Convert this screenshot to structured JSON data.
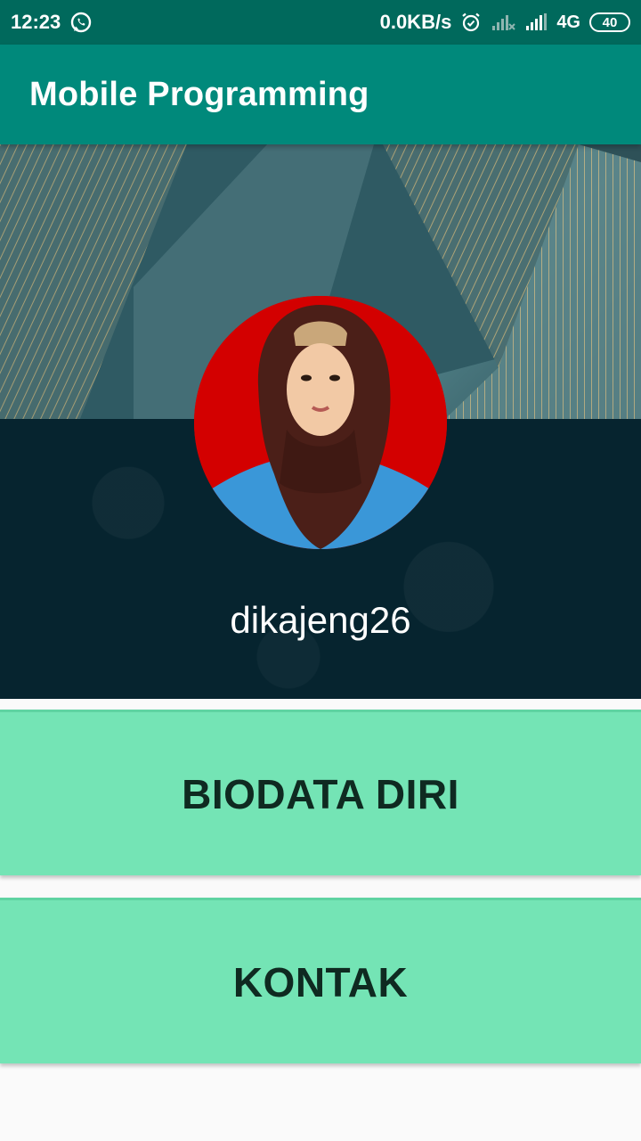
{
  "status_bar": {
    "time": "12:23",
    "app_icon": "whatsapp-icon",
    "net_speed": "0.0KB/s",
    "alarm_icon": "alarm-icon",
    "network_type": "4G",
    "battery_level": "40"
  },
  "app_bar": {
    "title": "Mobile Programming"
  },
  "profile": {
    "username": "dikajeng26"
  },
  "menu": {
    "biodata_label": "BIODATA DIRI",
    "kontak_label": "KONTAK"
  },
  "colors": {
    "status_bar": "#00695c",
    "app_bar": "#00897b",
    "button": "#74e4b5",
    "header_dark": "#06242f"
  }
}
